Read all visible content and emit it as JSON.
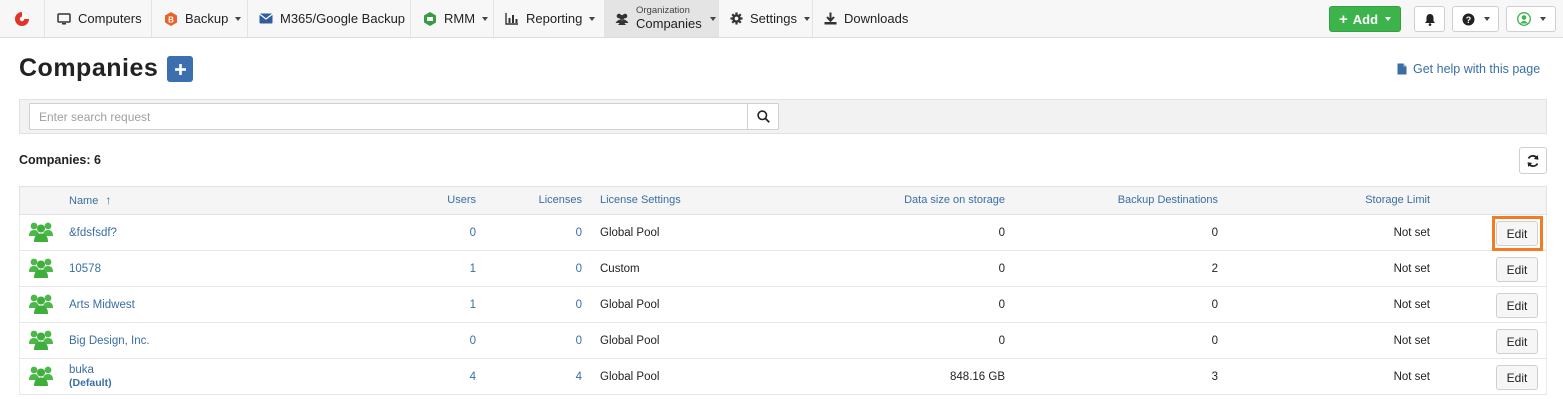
{
  "navbar": {
    "items": [
      {
        "label": "Computers",
        "icon": "monitor-icon"
      },
      {
        "label": "Backup",
        "icon": "backup-icon"
      },
      {
        "label": "M365/Google Backup",
        "icon": "envelope-icon"
      },
      {
        "label": "RMM",
        "icon": "rmm-icon"
      },
      {
        "label": "Reporting",
        "icon": "bar-chart-icon"
      },
      {
        "label": "Settings",
        "icon": "gear-icon"
      },
      {
        "label": "Downloads",
        "icon": "download-icon"
      }
    ],
    "org_small": "Organization",
    "org_big": "Companies",
    "add_label": "Add"
  },
  "page": {
    "title": "Companies",
    "help_link": "Get help with this page"
  },
  "search": {
    "placeholder": "Enter search request"
  },
  "companies_count": "Companies: 6",
  "table": {
    "columns": {
      "name": "Name",
      "users": "Users",
      "licenses": "Licenses",
      "license_settings": "License Settings",
      "data_size": "Data size on storage",
      "backup_dest": "Backup Destinations",
      "storage_limit": "Storage Limit"
    },
    "sort_indicator": "↑",
    "edit_label": "Edit",
    "rows": [
      {
        "name": "&fdsfsdf?",
        "tag": "",
        "users": "0",
        "licenses": "0",
        "license_settings": "Global Pool",
        "data_size": "0",
        "backup_dest": "0",
        "storage_limit": "Not set"
      },
      {
        "name": "10578",
        "tag": "",
        "users": "1",
        "licenses": "0",
        "license_settings": "Custom",
        "data_size": "0",
        "backup_dest": "2",
        "storage_limit": "Not set"
      },
      {
        "name": "Arts Midwest",
        "tag": "",
        "users": "1",
        "licenses": "0",
        "license_settings": "Global Pool",
        "data_size": "0",
        "backup_dest": "0",
        "storage_limit": "Not set"
      },
      {
        "name": "Big Design, Inc.",
        "tag": "",
        "users": "0",
        "licenses": "0",
        "license_settings": "Global Pool",
        "data_size": "0",
        "backup_dest": "0",
        "storage_limit": "Not set"
      },
      {
        "name": "buka",
        "tag": "(Default)",
        "users": "4",
        "licenses": "4",
        "license_settings": "Global Pool",
        "data_size": "848.16 GB",
        "backup_dest": "3",
        "storage_limit": "Not set"
      }
    ]
  },
  "colors": {
    "accent_green": "#3cb44b",
    "primary_blue": "#3c6fb0",
    "link_blue": "#3a6ea5",
    "highlight_orange": "#f47c20",
    "logo_red": "#e2352a"
  }
}
